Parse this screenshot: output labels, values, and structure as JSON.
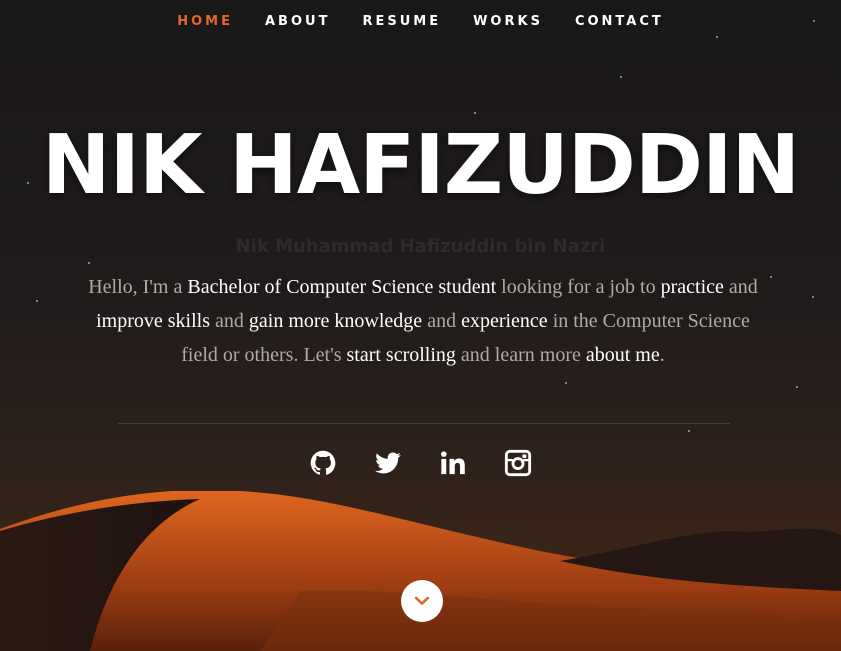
{
  "nav": {
    "items": [
      {
        "label": "HOME",
        "active": true
      },
      {
        "label": "ABOUT",
        "active": false
      },
      {
        "label": "RESUME",
        "active": false
      },
      {
        "label": "WORKS",
        "active": false
      },
      {
        "label": "CONTACT",
        "active": false
      }
    ]
  },
  "hero": {
    "title": "NIK HAFIZUDDIN",
    "subtitle": "Nik Muhammad Hafizuddin bin Nazri",
    "bio": [
      {
        "text": "Hello, I'm a ",
        "highlight": false
      },
      {
        "text": "Bachelor of Computer Science student",
        "highlight": true
      },
      {
        "text": " looking for a job to ",
        "highlight": false
      },
      {
        "text": "practice",
        "highlight": true
      },
      {
        "text": " and ",
        "highlight": false
      },
      {
        "text": "improve skills",
        "highlight": true
      },
      {
        "text": " and ",
        "highlight": false
      },
      {
        "text": "gain more knowledge",
        "highlight": true
      },
      {
        "text": " and ",
        "highlight": false
      },
      {
        "text": "experience",
        "highlight": true
      },
      {
        "text": " in the Computer Science field or others. Let's ",
        "highlight": false
      },
      {
        "text": "start scrolling",
        "highlight": true
      },
      {
        "text": " and learn more ",
        "highlight": false
      },
      {
        "text": "about me",
        "highlight": true
      },
      {
        "text": ".",
        "highlight": false
      }
    ]
  },
  "socials": [
    {
      "icon": "github-icon"
    },
    {
      "icon": "twitter-icon"
    },
    {
      "icon": "linkedin-icon"
    },
    {
      "icon": "instagram-icon"
    }
  ],
  "scroll_button": {
    "icon": "chevron-down-icon"
  },
  "colors": {
    "accent": "#e06a2b",
    "text": "#ffffff",
    "muted_text": "#b0aaa6",
    "background": "#1d1a1a"
  }
}
